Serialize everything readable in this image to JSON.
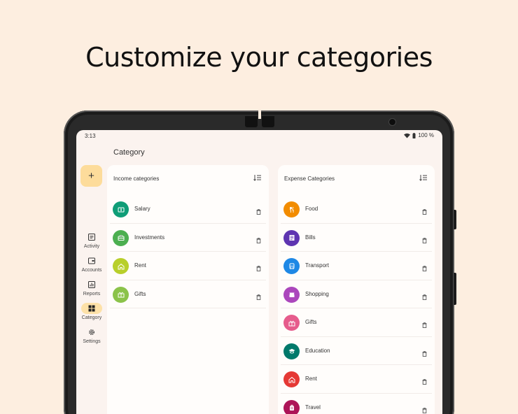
{
  "headline": "Customize your categories",
  "status": {
    "time": "3:13",
    "battery": "100 %"
  },
  "page_title": "Category",
  "fab_label": "+",
  "nav": [
    {
      "label": "Activity",
      "icon": "activity-icon",
      "active": false
    },
    {
      "label": "Accounts",
      "icon": "wallet-icon",
      "active": false
    },
    {
      "label": "Reports",
      "icon": "chart-icon",
      "active": false
    },
    {
      "label": "Category",
      "icon": "grid-icon",
      "active": true
    },
    {
      "label": "Settings",
      "icon": "gear-icon",
      "active": false
    }
  ],
  "income": {
    "title": "Income categories",
    "items": [
      {
        "label": "Salary",
        "color": "#0f9d77",
        "icon": "money-icon"
      },
      {
        "label": "Investments",
        "color": "#4caf50",
        "icon": "briefcase-icon"
      },
      {
        "label": "Rent",
        "color": "#b8cf2b",
        "icon": "home-icon"
      },
      {
        "label": "Gifts",
        "color": "#8bc34a",
        "icon": "gift-icon"
      }
    ]
  },
  "expense": {
    "title": "Expense Categories",
    "items": [
      {
        "label": "Food",
        "color": "#f28c00",
        "icon": "fork-knife-icon"
      },
      {
        "label": "Bills",
        "color": "#5e35b1",
        "icon": "receipt-icon"
      },
      {
        "label": "Transport",
        "color": "#1e88e5",
        "icon": "bus-icon"
      },
      {
        "label": "Shopping",
        "color": "#ab47bc",
        "icon": "cart-icon"
      },
      {
        "label": "Gifts",
        "color": "#e65c8c",
        "icon": "gift-icon"
      },
      {
        "label": "Education",
        "color": "#00796b",
        "icon": "school-icon"
      },
      {
        "label": "Rent",
        "color": "#e53935",
        "icon": "home-icon"
      },
      {
        "label": "Travel",
        "color": "#ad1457",
        "icon": "luggage-icon"
      }
    ]
  }
}
